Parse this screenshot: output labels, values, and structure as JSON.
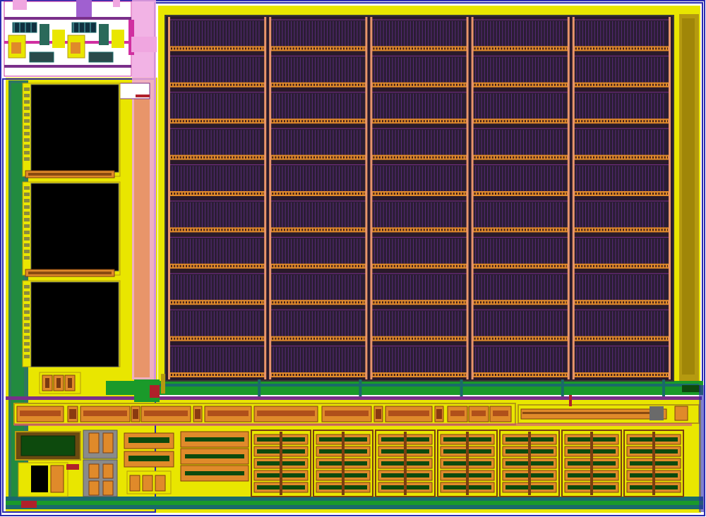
{
  "layout_view": {
    "colors": {
      "boundary": "#2b2bb0",
      "fill_yellow": "#e9e600",
      "olive": "#b59a10",
      "orange": "#e08a2a",
      "salmon": "#e8956a",
      "purple": "#7a2f8a",
      "magenta": "#d02fa0",
      "pink": "#f0a6e0",
      "dark_cell": "#2a1a2a",
      "black": "#000000",
      "green": "#1a9a2a",
      "teal": "#1a6a6a",
      "dark_green": "#0d4a0d",
      "brown": "#7a3f10",
      "red": "#b0202a"
    },
    "array": {
      "columns": 5,
      "rows": 10
    },
    "memory_macros": {
      "count": 3
    },
    "driver_strip": {
      "segments": 14
    },
    "bottom_blocks": {
      "count": 7,
      "stripes_per_block": 5
    }
  }
}
